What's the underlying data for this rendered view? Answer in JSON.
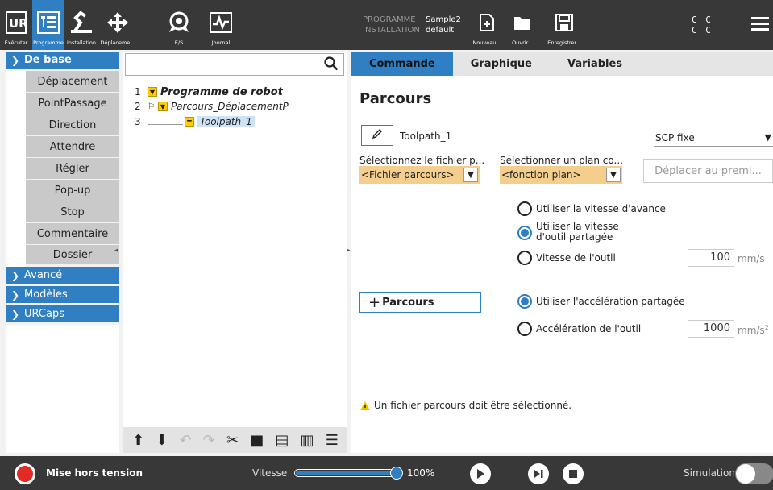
{
  "header": {
    "buttons": [
      {
        "label": "Exécuter",
        "icon": "ur-logo-icon"
      },
      {
        "label": "Programme",
        "icon": "program-icon",
        "active": true
      },
      {
        "label": "Installation",
        "icon": "installation-icon"
      },
      {
        "label": "Déplaceme...",
        "icon": "move-icon"
      },
      {
        "label": "E/S",
        "icon": "io-icon"
      },
      {
        "label": "Journal",
        "icon": "log-icon"
      }
    ],
    "program_key": "PROGRAMME",
    "program_value": "Sample2",
    "installation_key": "INSTALLATION",
    "installation_value": "default",
    "file_buttons": [
      {
        "label": "Nouveau...",
        "icon": "new-file-icon"
      },
      {
        "label": "Ouvrir...",
        "icon": "open-folder-icon"
      },
      {
        "label": "Enregistrer...",
        "icon": "save-icon"
      }
    ],
    "cc_line1": "C C",
    "cc_line2": "C C"
  },
  "leftnav": {
    "basic": {
      "label": "De base"
    },
    "items": [
      "Déplacement",
      "PointPassage",
      "Direction",
      "Attendre",
      "Régler",
      "Pop-up",
      "Stop",
      "Commentaire",
      "Dossier"
    ],
    "advanced": {
      "label": "Avancé"
    },
    "templates": {
      "label": "Modèles"
    },
    "urcaps": {
      "label": "URCaps"
    }
  },
  "tree": {
    "search_placeholder": "",
    "rows": [
      {
        "num": "1",
        "label": "Programme de robot"
      },
      {
        "num": "2",
        "label": "Parcours_DéplacementP"
      },
      {
        "num": "3",
        "label": "Toolpath_1"
      }
    ]
  },
  "tabs": [
    "Commande",
    "Graphique",
    "Variables"
  ],
  "main": {
    "title": "Parcours",
    "toolpath_name": "Toolpath_1",
    "frame_select": "SCP fixe",
    "file_label": "Sélectionnez le fichier p...",
    "file_value": "<Fichier parcours>",
    "plane_label": "Sélectionner un plan co...",
    "plane_value": "<fonction plan>",
    "move_first_button": "Déplacer au premi...",
    "speed_options": [
      {
        "label": "Utiliser la vitesse d'avance",
        "selected": false
      },
      {
        "label": "Utiliser la vitesse d'outil partagée",
        "selected": true
      },
      {
        "label": "Vitesse de l'outil",
        "selected": false
      }
    ],
    "tool_speed_value": "100",
    "tool_speed_unit": "mm/s",
    "path_button": "Parcours",
    "accel_options": [
      {
        "label": "Utiliser l'accélération partagée",
        "selected": true
      },
      {
        "label": "Accélération de l'outil",
        "selected": false
      }
    ],
    "tool_accel_value": "1000",
    "tool_accel_unit": "mm/s",
    "tool_accel_unit_exp": "2",
    "warning": "Un fichier parcours doit être sélectionné."
  },
  "footer": {
    "power_label": "Mise hors tension",
    "speed_label": "Vitesse",
    "speed_value": "100%",
    "speed_fraction": 1.0,
    "simulation_label": "Simulation",
    "simulation_on": false
  },
  "colors": {
    "accent": "#2f7fc2",
    "header": "#383838",
    "dropdown_warning": "#f3ce8c",
    "power": "#e32b25",
    "tree_marker": "#ffcc00"
  }
}
